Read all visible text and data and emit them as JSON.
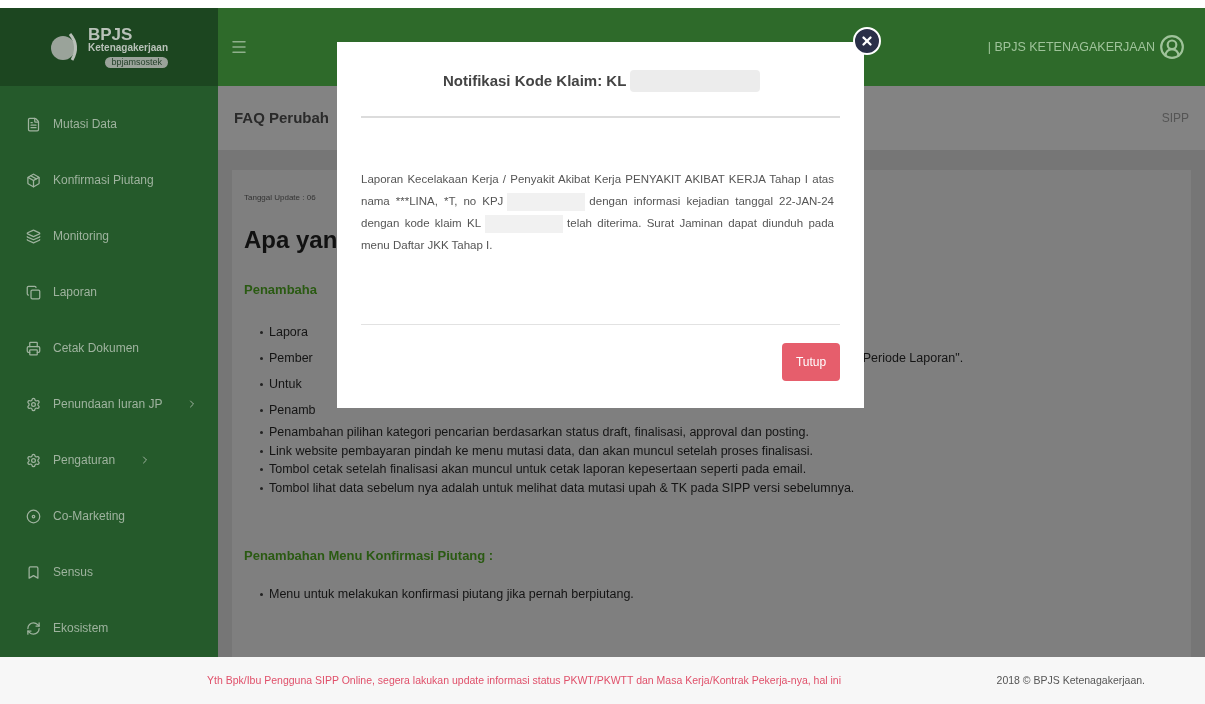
{
  "logo": {
    "name": "BPJS",
    "subtitle": "Ketenagakerjaan",
    "badge": "bpjamsostek"
  },
  "header": {
    "org": "| BPJS KETENAGAKERJAAN"
  },
  "sidebar": {
    "items": [
      {
        "label": "Mutasi Data",
        "has_submenu": false
      },
      {
        "label": "Konfirmasi Piutang",
        "has_submenu": false
      },
      {
        "label": "Monitoring",
        "has_submenu": false
      },
      {
        "label": "Laporan",
        "has_submenu": false
      },
      {
        "label": "Cetak Dokumen",
        "has_submenu": false
      },
      {
        "label": "Penundaan Iuran JP",
        "has_submenu": true
      },
      {
        "label": "Pengaturan",
        "has_submenu": true
      },
      {
        "label": "Co-Marketing",
        "has_submenu": false
      },
      {
        "label": "Sensus",
        "has_submenu": false
      },
      {
        "label": "Ekosistem",
        "has_submenu": false
      }
    ]
  },
  "page": {
    "title": "FAQ Perubah",
    "breadcrumb": "SIPP",
    "update_date": "Tanggal Update : 06",
    "heading": "Apa yan",
    "sections": [
      {
        "title": "Penambaha",
        "bullets": [
          {
            "text": "Lapora"
          },
          {
            "text": "Pember",
            "tail": "Periode Laporan\"."
          },
          {
            "text": "Untuk"
          },
          {
            "text": "Penamb"
          },
          {
            "text": "Penambahan pilihan kategori pencarian berdasarkan status draft, finalisasi, approval dan posting."
          },
          {
            "text": "Link website pembayaran pindah ke menu mutasi data, dan akan muncul setelah proses finalisasi."
          },
          {
            "text": "Tombol cetak setelah finalisasi akan muncul untuk cetak laporan kepesertaan seperti pada email."
          },
          {
            "text": "Tombol lihat data sebelum nya adalah untuk melihat data mutasi upah & TK pada SIPP versi sebelumnya."
          }
        ]
      },
      {
        "title": "Penambahan Menu Konfirmasi Piutang :",
        "bullets": [
          {
            "text": "Menu untuk melakukan konfirmasi piutang jika pernah berpiutang."
          }
        ]
      }
    ]
  },
  "modal": {
    "title": "Notifikasi Kode Klaim: KL",
    "message": [
      "Laporan Kecelakaan Kerja / Penyakit Akibat Kerja PENYAKIT AKIBAT KERJA Tahap I atas nama ***LINA, *T, no KPJ",
      "dengan informasi kejadian tanggal 22-JAN-24 dengan kode klaim KL",
      "telah diterima. Surat Jaminan dapat diunduh pada menu Daftar JKK Tahap I."
    ],
    "button": "Tutup"
  },
  "footer": {
    "notice": "Yth Bpk/Ibu Pengguna SIPP Online, segera lakukan update informasi status PKWT/PKWTT dan Masa Kerja/Kontrak Pekerja-nya, hal ini",
    "copyright": "2018 © BPJS Ketenagakerjaan."
  }
}
